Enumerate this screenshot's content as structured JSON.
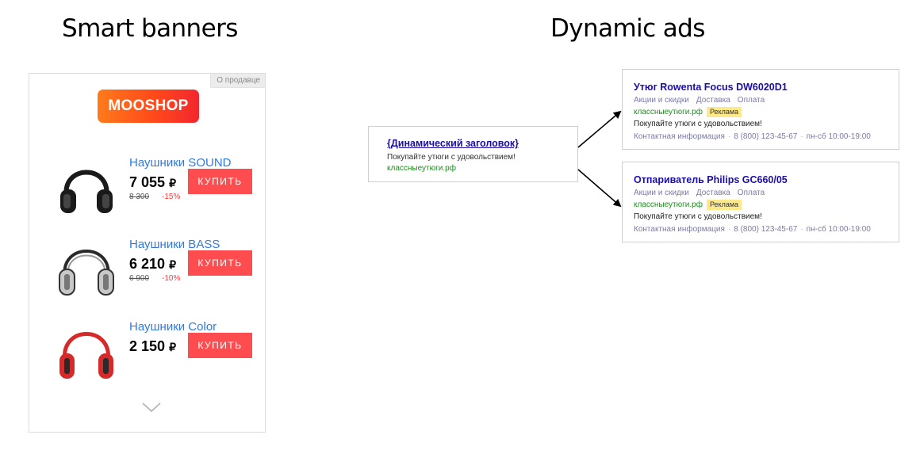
{
  "titles": {
    "smart": "Smart banners",
    "dynamic": "Dynamic ads"
  },
  "banner": {
    "seller_tag": "О продавце",
    "logo": "MOOSHOP",
    "currency": "₽",
    "buy_label": "КУПИТЬ",
    "products": [
      {
        "name": "Наушники SOUND",
        "price": "7 055",
        "old_price": "8 300",
        "discount": "-15%",
        "color": "#1a1a1a"
      },
      {
        "name": "Наушники BASS",
        "price": "6 210",
        "old_price": "6 900",
        "discount": "-10%",
        "color": "#b9b9b9"
      },
      {
        "name": "Наушники Color",
        "price": "2 150",
        "old_price": "",
        "discount": "",
        "color": "#d62a2a"
      }
    ]
  },
  "template_ad": {
    "headline": "{Динамический заголовок}",
    "text": "Покупайте утюги с удовольствием!",
    "url": "классныеутюги.рф"
  },
  "ads": [
    {
      "headline": "Утюг Rowenta Focus DW6020D1",
      "links": [
        "Акции и скидки",
        "Доставка",
        "Оплата"
      ],
      "url": "классныеутюги.рф",
      "badge": "Реклама",
      "text": "Покупайте утюги с удовольствием!",
      "contact": "Контактная информация",
      "phone": "8 (800) 123-45-67",
      "hours": "пн-сб 10:00-19:00"
    },
    {
      "headline": "Отпариватель Philips GC660/05",
      "links": [
        "Акции и скидки",
        "Доставка",
        "Оплата"
      ],
      "url": "классныеутюги.рф",
      "badge": "Реклама",
      "text": "Покупайте утюги с удовольствием!",
      "contact": "Контактная информация",
      "phone": "8 (800) 123-45-67",
      "hours": "пн-сб 10:00-19:00"
    }
  ],
  "colors": {
    "buy_button": "#ff4d4f",
    "product_link": "#2f7ae5",
    "ad_headline": "#1a0dab",
    "ad_url": "#1a8f1a",
    "badge": "#fde98a"
  },
  "icons": [
    "headphones-icon",
    "chevron-down-icon",
    "arrow-icon"
  ]
}
